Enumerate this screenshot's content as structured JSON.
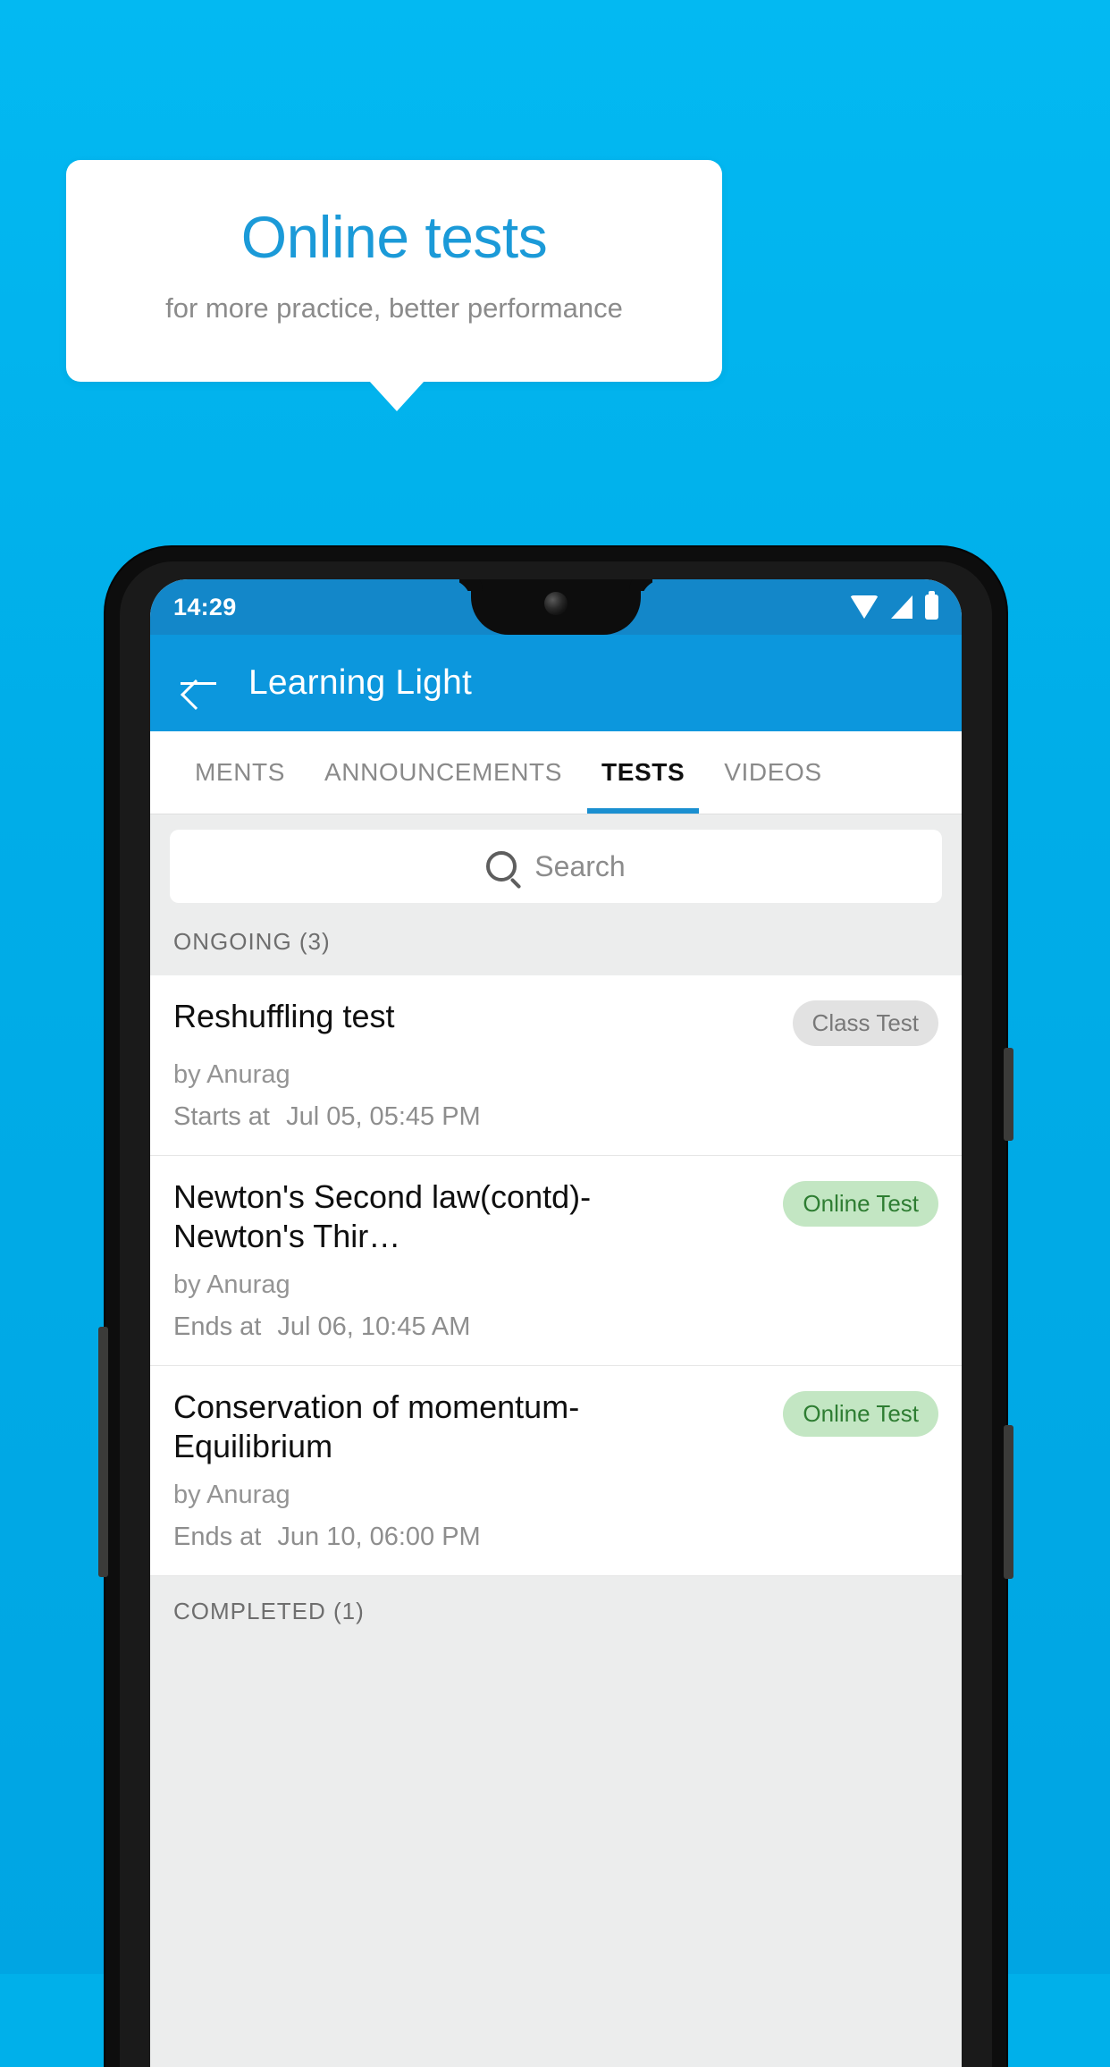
{
  "promo": {
    "title": "Online tests",
    "subtitle": "for more practice, better performance"
  },
  "colors": {
    "background": "#00ade8",
    "promo_title": "#1b9ad8",
    "appbar": "#0c97dd",
    "statusbar": "#1387c9",
    "tab_active_underline": "#1a8fd0",
    "badge_online_bg": "#c3e6c3",
    "badge_online_text": "#2e7d32",
    "badge_class_bg": "#e2e2e2",
    "badge_class_text": "#787878"
  },
  "status_bar": {
    "time": "14:29",
    "icons": [
      "wifi-icon",
      "signal-icon",
      "battery-icon"
    ]
  },
  "app_bar": {
    "back_icon": "back-arrow-icon",
    "title": "Learning Light"
  },
  "tabs": [
    {
      "label": "MENTS",
      "active": false
    },
    {
      "label": "ANNOUNCEMENTS",
      "active": false
    },
    {
      "label": "TESTS",
      "active": true
    },
    {
      "label": "VIDEOS",
      "active": false
    }
  ],
  "search": {
    "icon": "search-icon",
    "placeholder": "Search",
    "value": ""
  },
  "sections": [
    {
      "title": "ONGOING (3)"
    },
    {
      "title": "COMPLETED (1)"
    }
  ],
  "tests": [
    {
      "title": "Reshuffling test",
      "badge": "Class Test",
      "badge_type": "gray",
      "author": "by Anurag",
      "time_label": "Starts at",
      "time_value": "Jul 05, 05:45 PM"
    },
    {
      "title": "Newton's Second law(contd)-Newton's Thir…",
      "badge": "Online Test",
      "badge_type": "green",
      "author": "by Anurag",
      "time_label": "Ends at",
      "time_value": "Jul 06, 10:45 AM"
    },
    {
      "title": "Conservation of momentum-Equilibrium",
      "badge": "Online Test",
      "badge_type": "green",
      "author": "by Anurag",
      "time_label": "Ends at",
      "time_value": "Jun 10, 06:00 PM"
    }
  ]
}
